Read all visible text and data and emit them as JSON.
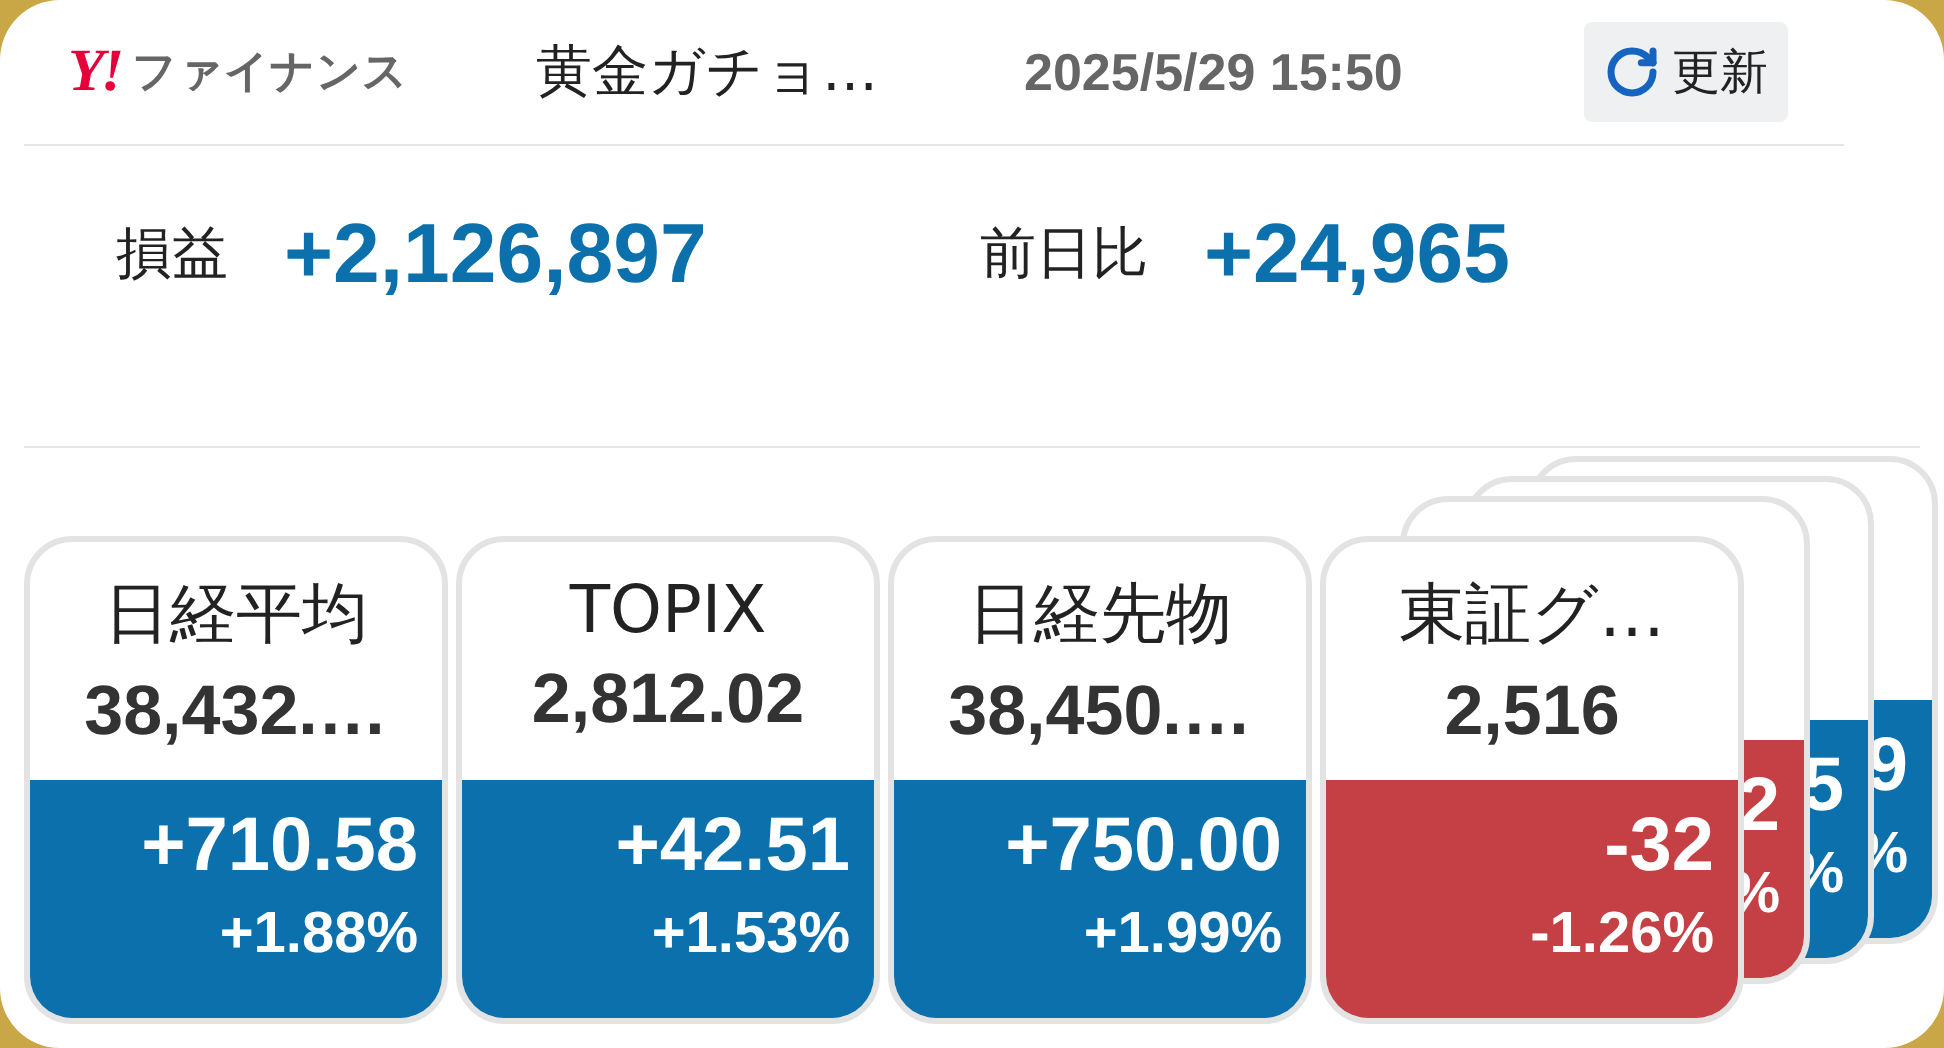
{
  "header": {
    "logo": "Y!",
    "brand": "ファイナンス",
    "title": "黄金ガチョ…",
    "datetime": "2025/5/29 15:50",
    "refresh_button": "更新"
  },
  "summary": [
    {
      "label": "損益",
      "value": "+2,126,897"
    },
    {
      "label": "前日比",
      "value": "+24,965"
    }
  ],
  "cards": [
    {
      "name": "日経平均",
      "price": "38,432.…",
      "change": "+710.58",
      "percent": "+1.88%",
      "color": "#0b70ab"
    },
    {
      "name": "TOPIX",
      "price": "2,812.02",
      "change": "+42.51",
      "percent": "+1.53%",
      "color": "#0b70ab"
    },
    {
      "name": "日経先物",
      "price": "38,450.…",
      "change": "+750.00",
      "percent": "+1.99%",
      "color": "#0b70ab"
    },
    {
      "name": "東証グ…",
      "price": "2,516",
      "change": "-32",
      "percent": "-1.26%",
      "color": "#c54044"
    }
  ],
  "stacked_cards": [
    {
      "change": "2",
      "percent": "%",
      "color": "#c54044"
    },
    {
      "change": "5",
      "percent": "%",
      "color": "#0b70ab"
    },
    {
      "change": "9",
      "percent": "%",
      "color": "#0b70ab"
    }
  ]
}
